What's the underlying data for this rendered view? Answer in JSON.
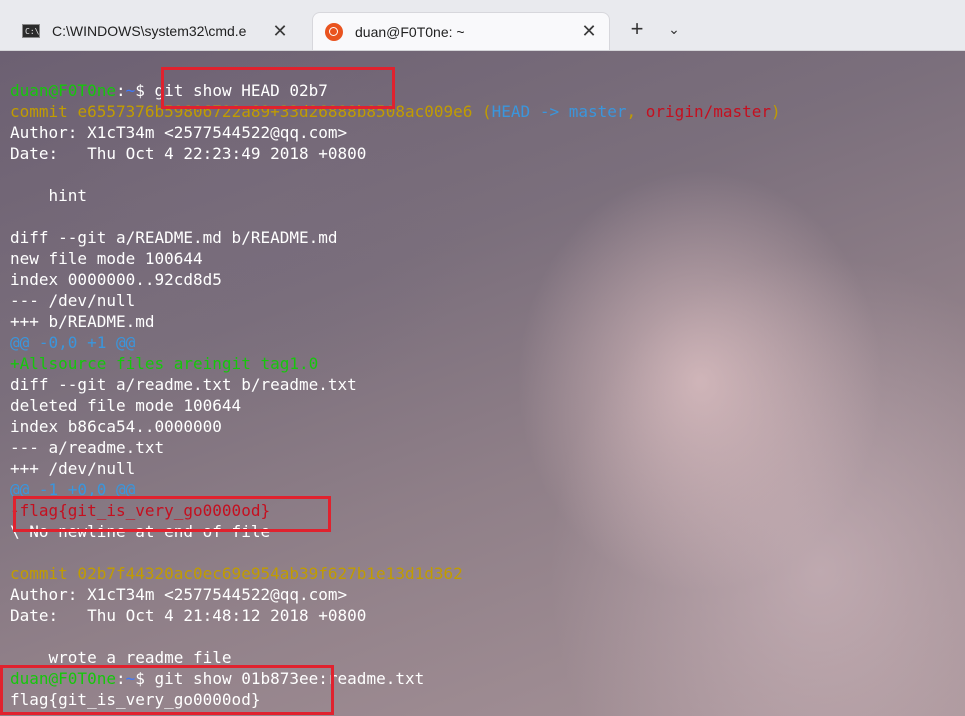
{
  "tabs": [
    {
      "title": "C:\\WINDOWS\\system32\\cmd.e",
      "icon": "cmd-icon",
      "active": false
    },
    {
      "title": "duan@F0T0ne: ~",
      "icon": "ubuntu-icon",
      "active": true
    }
  ],
  "tabbar": {
    "new_tab": "+",
    "dropdown": "⌄",
    "close": "✕"
  },
  "terminal": {
    "prompt_user": "duan@F0T0ne",
    "prompt_sep": ":",
    "prompt_path": "~",
    "prompt_dollar": "$ ",
    "cmd1": "git show HEAD 02b7",
    "commit1_prefix": "commit ",
    "commit1_hash": "e6557376b59806722a89+33d26888b8508ac009e6",
    "commit1_open": " (",
    "commit1_head": "HEAD -> master",
    "commit1_comma": ", ",
    "commit1_origin": "origin/master",
    "commit1_close": ")",
    "author1": "Author: X1cT34m <2577544522@qq.com>",
    "date1": "Date:   Thu Oct 4 22:23:49 2018 +0800",
    "msg1": "    hint",
    "diff1": "diff --git a/README.md b/README.md",
    "newmode": "new file mode 100644",
    "index1": "index 0000000..92cd8d5",
    "minus1": "--- /dev/null",
    "plus1": "+++ b/README.md",
    "hunk1": "@@ -0,0 +1 @@",
    "added1": "+Allsource files areingit tag1.0",
    "diff2": "diff --git a/readme.txt b/readme.txt",
    "delmode": "deleted file mode 100644",
    "index2": "index b86ca54..0000000",
    "minus2": "--- a/readme.txt",
    "plus2": "+++ /dev/null",
    "hunk2": "@@ -1 +0,0 @@",
    "removed": "-flag{git_is_very_go0000od}",
    "nonewline": "\\ No newline at end of file",
    "commit2": "commit 02b7f44320ac0ec69e954ab39f627b1e13d1d362",
    "author2": "Author: X1cT34m <2577544522@qq.com>",
    "date2": "Date:   Thu Oct 4 21:48:12 2018 +0800",
    "msg2": "    wrote a readme file",
    "cmd2": "git show 01b873ee:readme.txt",
    "output": "flag{git_is_very_go0000od}"
  },
  "colors": {
    "prompt_user": "#16c60c",
    "prompt_path": "#3b78ff",
    "commit": "#c19c00",
    "head": "#3a96dd",
    "origin": "#c50f1f",
    "highlight_box": "#e0222e"
  }
}
